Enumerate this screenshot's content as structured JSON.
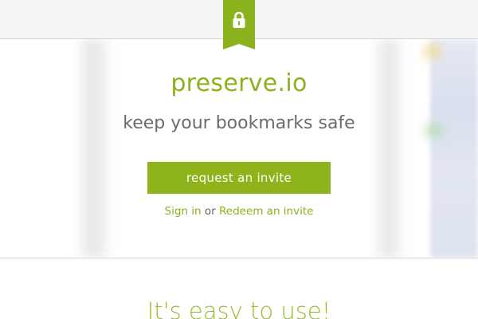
{
  "header": {
    "ribbon_icon": "lock-icon",
    "accent_color": "#8ab21d"
  },
  "hero": {
    "brand": "preserve.io",
    "tagline": "keep your bookmarks safe",
    "cta_label": "request an invite",
    "sign_in_label": "Sign in",
    "separator": "or",
    "redeem_label": "Redeem an invite"
  },
  "features": {
    "title": "It's easy to use!"
  },
  "colors": {
    "brand_green": "#8ab21d",
    "button_green": "#8fb31a",
    "tagline_gray": "#6b6b6b",
    "topbar_bg": "#f5f5f5"
  }
}
